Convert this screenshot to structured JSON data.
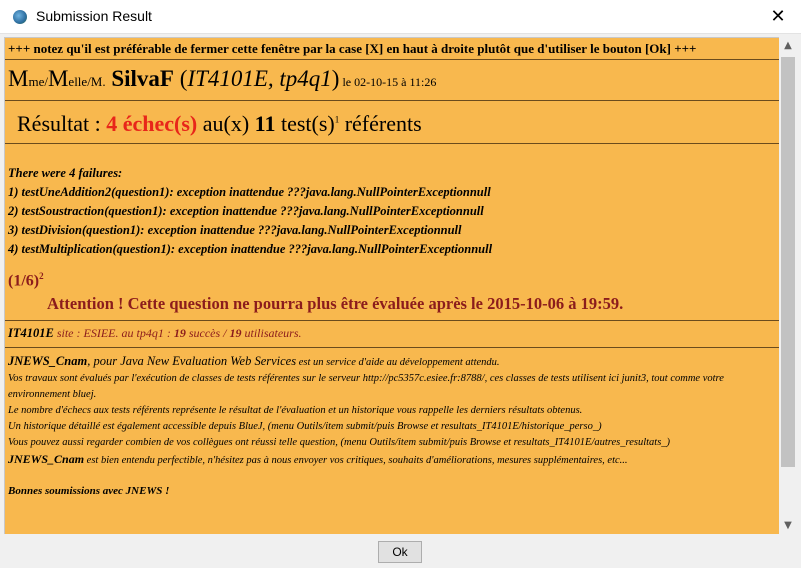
{
  "window": {
    "title": "Submission Result",
    "close_glyph": "✕",
    "icon": "java-globe-icon"
  },
  "warning": "+++ notez qu'il est préférable de fermer cette fenêtre par la case [X] en haut à droite plutôt que d'utiliser le bouton [Ok] +++",
  "user": {
    "m1": "M",
    "me": "me",
    "slash1": "/",
    "m2": "M",
    "elle": "elle",
    "slash2": "/M.",
    "name": "SilvaF",
    "course_open": " (",
    "course": "IT4101E, tp4q1",
    "course_close": ")",
    "date": " le 02-10-15 à 11:26"
  },
  "result": {
    "label": "Résultat : ",
    "fail_count": "4 échec(s)",
    "middle": " au(x) ",
    "test_count": "11",
    "test_word": " test(s)",
    "sup": "1",
    "end": " référents"
  },
  "failures": {
    "header": "There were 4 failures:",
    "items": [
      "1) testUneAddition2(question1): exception inattendue ???java.lang.NullPointerExceptionnull",
      "2) testSoustraction(question1): exception inattendue ???java.lang.NullPointerExceptionnull",
      "3) testDivision(question1): exception inattendue ???java.lang.NullPointerExceptionnull",
      "4) testMultiplication(question1): exception inattendue ???java.lang.NullPointerExceptionnull"
    ]
  },
  "fraction": {
    "value": "(1/6)",
    "sup": "2"
  },
  "attention": "Attention ! Cette question ne pourra plus être évaluée après le 2015-10-06 à 19:59.",
  "course_line": {
    "code": "IT4101E",
    "site": " site : ESIEE.",
    "au": " au ",
    "tp": "tp4q1",
    "colon": " : ",
    "succ": "19",
    "succ_label": " succès / ",
    "users": "19",
    "users_label": " utilisateurs."
  },
  "info": {
    "jn": "JNEWS_Cnam",
    "pour": ", pour ",
    "java": "Java New Evaluation Web Services",
    "rest": " est un service d'aide au développement attendu.",
    "l2": "Vos travaux sont évalués par l'exécution de classes de tests référentes sur le serveur http://pc5357c.esiee.fr:8788/, ces classes de tests utilisent ici junit3, tout comme votre environnement bluej.",
    "l3": "Le nombre d'échecs aux tests référents représente le résultat de l'évaluation et un historique vous rappelle les derniers résultats obtenus.",
    "l4": "Un historique détaillé est également accessible depuis BlueJ, (menu Outils/item submit/puis Browse et resultats_IT4101E/historique_perso_)",
    "l5": "Vous pouvez aussi regarder combien de vos collègues ont réussi telle question, (menu Outils/item submit/puis Browse et resultats_IT4101E/autres_resultats_)",
    "jn2": "JNEWS_Cnam",
    "l6": " est bien entendu perfectible, n'hésitez pas à nous envoyer vos critiques, souhaits d'améliorations, mesures supplémentaires, etc...",
    "bonnes": "Bonnes soumissions avec JNEWS !"
  },
  "ok_label": "Ok",
  "scrollbar": {
    "up": "▲",
    "down": "▼"
  }
}
